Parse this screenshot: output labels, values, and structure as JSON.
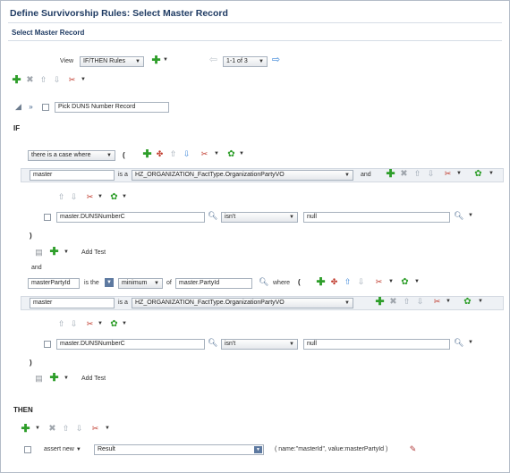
{
  "page": {
    "title": "Define Survivorship Rules: Select Master Record",
    "subtitle": "Select Master Record"
  },
  "toolbar": {
    "view_label": "View",
    "view_value": "IF/THEN Rules",
    "pager_value": "1-1 of 3"
  },
  "rule": {
    "name": "Pick DUNS Number Record"
  },
  "if": {
    "label": "IF",
    "case_value": "there is a case where",
    "open_paren": "(",
    "cond1": {
      "var": "master",
      "is_a": "is a",
      "type": "HZ_ORGANIZATION_FactType.OrganizationPartyVO",
      "and": "and",
      "test": {
        "left": "master.DUNSNumberC",
        "op": "isn't",
        "right": "null"
      },
      "close_paren": ")",
      "add_test": "Add Test"
    },
    "and_label": "and",
    "cond2": {
      "var": "masterPartyId",
      "is_the": "is the",
      "agg": "minimum",
      "of": "of",
      "of_value": "master.PartyId",
      "where": "where",
      "open_paren": "(",
      "inner_var": "master",
      "is_a": "is a",
      "type": "HZ_ORGANIZATION_FactType.OrganizationPartyVO",
      "test": {
        "left": "master.DUNSNumberC",
        "op": "isn't",
        "right": "null"
      },
      "close_paren": ")",
      "add_test": "Add Test"
    }
  },
  "then": {
    "label": "THEN",
    "action": "assert new",
    "target": "Result",
    "args": "( name:\"masterId\", value:masterPartyId )"
  }
}
